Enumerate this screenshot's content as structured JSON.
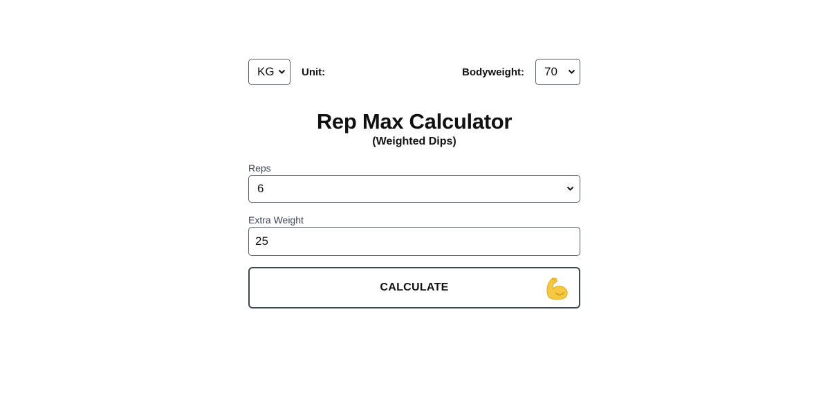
{
  "header": {
    "unit_select_value": "KG",
    "unit_label": "Unit:",
    "bodyweight_label": "Bodyweight:",
    "bodyweight_select_value": "70"
  },
  "title": "Rep Max Calculator",
  "subtitle": "(Weighted Dips)",
  "form": {
    "reps_label": "Reps",
    "reps_value": "6",
    "extra_weight_label": "Extra Weight",
    "extra_weight_value": "25"
  },
  "calculate_button": {
    "label": "CALCULATE",
    "icon": "flexed-biceps-icon"
  },
  "colors": {
    "border": "#555b66",
    "button_border": "#3f4652",
    "label": "#3c4454",
    "emoji_yellow": "#f5c842"
  }
}
